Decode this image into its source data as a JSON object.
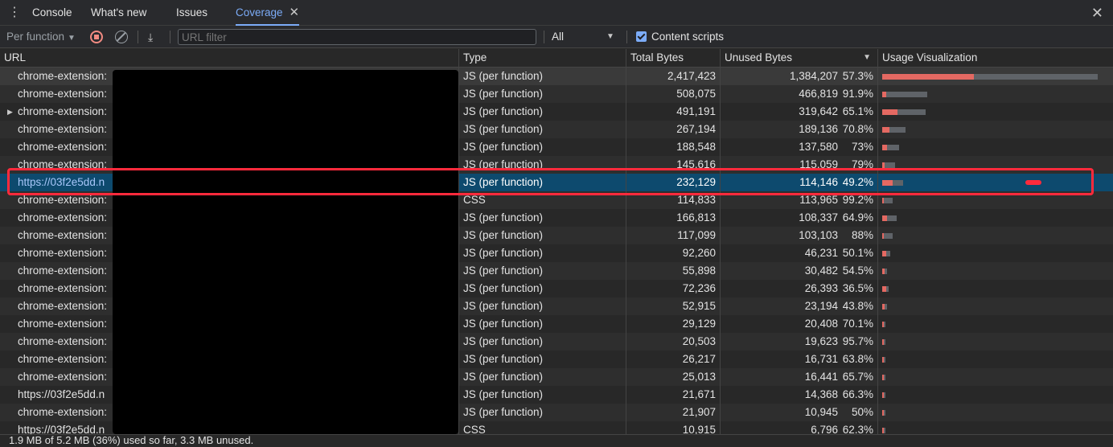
{
  "tabs": [
    {
      "label": "Console"
    },
    {
      "label": "What's new"
    },
    {
      "label": "Issues"
    },
    {
      "label": "Coverage",
      "active": true
    }
  ],
  "toolbar": {
    "mode_label": "Per function",
    "filter_placeholder": "URL filter",
    "type_filter": "All",
    "content_scripts_label": "Content scripts",
    "content_scripts_checked": true
  },
  "columns": {
    "url": "URL",
    "type": "Type",
    "total": "Total Bytes",
    "unused": "Unused Bytes",
    "viz": "Usage Visualization"
  },
  "rows": [
    {
      "url": "chrome-extension:",
      "type": "JS (per function)",
      "total": "2,417,423",
      "unused": "1,384,207",
      "pct": "57.3%",
      "used_fraction": 0.427,
      "total_fraction": 1.0
    },
    {
      "url": "chrome-extension:",
      "type": "JS (per function)",
      "total": "508,075",
      "unused": "466,819",
      "pct": "91.9%",
      "used_fraction": 0.081,
      "total_fraction": 0.21
    },
    {
      "url": "chrome-extension:",
      "type": "JS (per function)",
      "total": "491,191",
      "unused": "319,642",
      "pct": "65.1%",
      "used_fraction": 0.349,
      "total_fraction": 0.203,
      "expandable": true
    },
    {
      "url": "chrome-extension:",
      "type": "JS (per function)",
      "total": "267,194",
      "unused": "189,136",
      "pct": "70.8%",
      "used_fraction": 0.292,
      "total_fraction": 0.11
    },
    {
      "url": "chrome-extension:",
      "type": "JS (per function)",
      "total": "188,548",
      "unused": "137,580",
      "pct": "73%",
      "used_fraction": 0.27,
      "total_fraction": 0.078
    },
    {
      "url": "chrome-extension:",
      "type": "JS (per function)",
      "total": "145,616",
      "unused": "115,059",
      "pct": "79%",
      "used_fraction": 0.21,
      "total_fraction": 0.06
    },
    {
      "url": "https://03f2e5dd.n",
      "type": "JS (per function)",
      "total": "232,129",
      "unused": "114,146",
      "pct": "49.2%",
      "used_fraction": 0.508,
      "total_fraction": 0.096,
      "selected": true
    },
    {
      "url": "chrome-extension:",
      "type": "CSS",
      "total": "114,833",
      "unused": "113,965",
      "pct": "99.2%",
      "used_fraction": 0.008,
      "total_fraction": 0.047
    },
    {
      "url": "chrome-extension:",
      "type": "JS (per function)",
      "total": "166,813",
      "unused": "108,337",
      "pct": "64.9%",
      "used_fraction": 0.351,
      "total_fraction": 0.069
    },
    {
      "url": "chrome-extension:",
      "type": "JS (per function)",
      "total": "117,099",
      "unused": "103,103",
      "pct": "88%",
      "used_fraction": 0.12,
      "total_fraction": 0.048
    },
    {
      "url": "chrome-extension:",
      "type": "JS (per function)",
      "total": "92,260",
      "unused": "46,231",
      "pct": "50.1%",
      "used_fraction": 0.499,
      "total_fraction": 0.038
    },
    {
      "url": "chrome-extension:",
      "type": "JS (per function)",
      "total": "55,898",
      "unused": "30,482",
      "pct": "54.5%",
      "used_fraction": 0.455,
      "total_fraction": 0.023
    },
    {
      "url": "chrome-extension:",
      "type": "JS (per function)",
      "total": "72,236",
      "unused": "26,393",
      "pct": "36.5%",
      "used_fraction": 0.635,
      "total_fraction": 0.03
    },
    {
      "url": "chrome-extension:",
      "type": "JS (per function)",
      "total": "52,915",
      "unused": "23,194",
      "pct": "43.8%",
      "used_fraction": 0.562,
      "total_fraction": 0.022
    },
    {
      "url": "chrome-extension:",
      "type": "JS (per function)",
      "total": "29,129",
      "unused": "20,408",
      "pct": "70.1%",
      "used_fraction": 0.299,
      "total_fraction": 0.012
    },
    {
      "url": "chrome-extension:",
      "type": "JS (per function)",
      "total": "20,503",
      "unused": "19,623",
      "pct": "95.7%",
      "used_fraction": 0.043,
      "total_fraction": 0.0085
    },
    {
      "url": "chrome-extension:",
      "type": "JS (per function)",
      "total": "26,217",
      "unused": "16,731",
      "pct": "63.8%",
      "used_fraction": 0.362,
      "total_fraction": 0.0108
    },
    {
      "url": "chrome-extension:",
      "type": "JS (per function)",
      "total": "25,013",
      "unused": "16,441",
      "pct": "65.7%",
      "used_fraction": 0.343,
      "total_fraction": 0.0103
    },
    {
      "url": "https://03f2e5dd.n",
      "type": "JS (per function)",
      "total": "21,671",
      "unused": "14,368",
      "pct": "66.3%",
      "used_fraction": 0.337,
      "total_fraction": 0.009
    },
    {
      "url": "chrome-extension:",
      "type": "JS (per function)",
      "total": "21,907",
      "unused": "10,945",
      "pct": "50%",
      "used_fraction": 0.5,
      "total_fraction": 0.009
    },
    {
      "url": "https://03f2e5dd.n",
      "type": "CSS",
      "total": "10,915",
      "unused": "6,796",
      "pct": "62.3%",
      "used_fraction": 0.377,
      "total_fraction": 0.0045
    }
  ],
  "status": "1.9 MB of 5.2 MB (36%) used so far, 3.3 MB unused.",
  "colors": {
    "accent": "#7cacf8",
    "used_bar": "#e46962",
    "unused_bar": "#5f6368",
    "selected_row": "#0d4a6e",
    "annotation": "#ff2a3c"
  }
}
